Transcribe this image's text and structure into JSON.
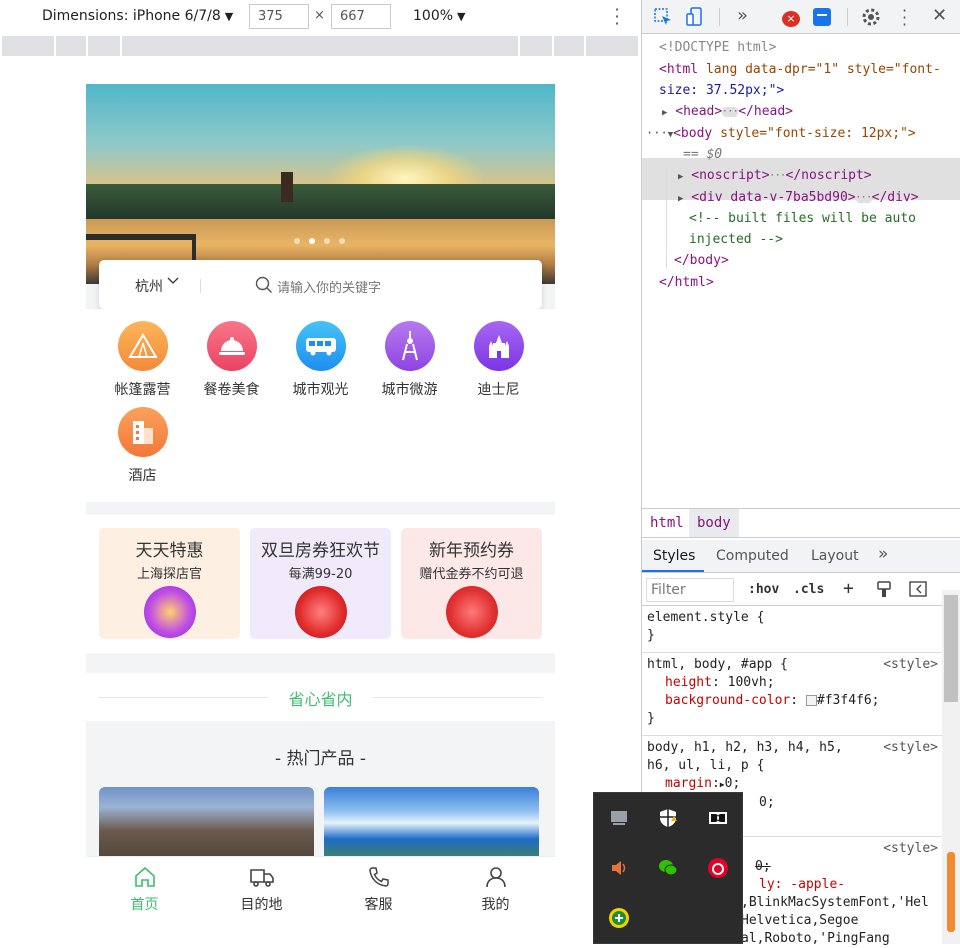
{
  "device_toolbar": {
    "dimensions_label": "Dimensions: iPhone 6/7/8",
    "width_value": "375",
    "height_value": "667",
    "times": "×",
    "zoom": "100%"
  },
  "app": {
    "city": "杭州",
    "search_placeholder": "请输入你的关键字",
    "categories": [
      {
        "label": "帐篷露营",
        "icon": "tent-icon",
        "color": "#f7a040"
      },
      {
        "label": "餐卷美食",
        "icon": "food-cloche-icon",
        "color": "#f0566f"
      },
      {
        "label": "城市观光",
        "icon": "tour-bus-icon",
        "color": "#2aa4f0"
      },
      {
        "label": "城市微游",
        "icon": "tower-icon",
        "color": "#a253e6"
      },
      {
        "label": "迪士尼",
        "icon": "castle-icon",
        "color": "#8e46ec"
      },
      {
        "label": "酒店",
        "icon": "hotel-icon",
        "color": "#f7833f"
      }
    ],
    "promos": [
      {
        "title": "天天特惠",
        "subtitle": "上海探店官"
      },
      {
        "title": "双旦房券狂欢节",
        "subtitle": "每满99-20"
      },
      {
        "title": "新年预约券",
        "subtitle": "赠代金券不约可退"
      }
    ],
    "save_section": "省心省内",
    "hot_title": "- 热门产品 -",
    "tabs": [
      {
        "label": "首页",
        "icon": "home-icon",
        "active": true
      },
      {
        "label": "目的地",
        "icon": "truck-icon",
        "active": false
      },
      {
        "label": "客服",
        "icon": "phone-icon",
        "active": false
      },
      {
        "label": "我的",
        "icon": "user-icon",
        "active": false
      }
    ]
  },
  "devtools": {
    "dom": {
      "doctype": "<!DOCTYPE html>",
      "html_open_tag": "<html",
      "html_attrs": " lang data-dpr=\"1\" style=\"font-",
      "html_attrs2": "size: 37.52px;\">",
      "head": "<head>",
      "head_close": "</head>",
      "body_open": "<body",
      "body_attrs": " style=\"font-size: 12px;\">",
      "dollar": "== $0",
      "noscript": "<noscript>",
      "noscript_close": "</noscript>",
      "div": "<div data-v-7ba5bd90>",
      "div_close": "</div>",
      "comment1": "<!-- built files will be auto",
      "comment2": "injected -->",
      "body_close": "</body>",
      "html_close": "</html>"
    },
    "breadcrumbs": [
      "html",
      "body"
    ],
    "panel_tabs": [
      "Styles",
      "Computed",
      "Layout"
    ],
    "more_tabs": "»",
    "filter_placeholder": "Filter",
    "hov": ":hov",
    "cls": ".cls",
    "plus": "+",
    "rules": {
      "element_style": "element.style {",
      "close": "}",
      "r1_selector": "html, body, #app {",
      "r1_source": "<style>",
      "r1_p1": "height",
      "r1_v1": "100vh;",
      "r1_p2": "background-color",
      "r1_v2": "#f3f4f6;",
      "r2_selector": "body, h1, h2, h3, h4, h5,",
      "r2_selector2": "h6, ul, li, p {",
      "r2_source": "<style>",
      "r2_p1": "margin",
      "r2_v1": "0;",
      "r2_v2": "0;",
      "r3_source": "<style>",
      "r3_a": "0;",
      "r3_b": "ly: -apple-",
      "r3_c": ",BlinkMacSystemFont,'Hel",
      "r3_d": "Helvetica,Segoe",
      "r3_e": "al,Roboto,'PingFang"
    }
  },
  "colors": {
    "accent_green": "#3cbf6e",
    "page_bg": "#f3f4f6",
    "devtools_blue": "#1a73e8"
  }
}
